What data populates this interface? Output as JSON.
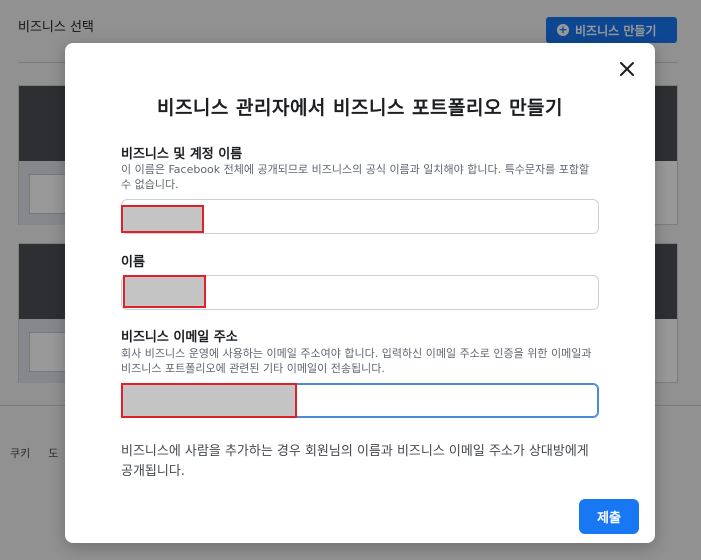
{
  "background": {
    "page_title": "비즈니스 선택",
    "create_button_label": "비즈니스 만들기",
    "footer_links": [
      "쿠키",
      "도"
    ]
  },
  "modal": {
    "title": "비즈니스 관리자에서 비즈니스 포트폴리오 만들기",
    "business_name": {
      "label": "비즈니스 및 계정 이름",
      "help": "이 이름은 Facebook 전체에 공개되므로 비즈니스의 공식 이름과 일치해야 합니다. 특수문자를 포함할 수 없습니다.",
      "value": ""
    },
    "name": {
      "label": "이름",
      "value": ""
    },
    "business_email": {
      "label": "비즈니스 이메일 주소",
      "help": "회사 비즈니스 운영에 사용하는 이메일 주소여야 합니다. 입력하신 이메일 주소로 인증을 위한 이메일과 비즈니스 포트폴리오에 관련된 기타 이메일이 전송됩니다.",
      "value": ""
    },
    "info": "비즈니스에 사람을 추가하는 경우 회원님의 이름과 비즈니스 이메일 주소가 상대방에게 공개됩니다.",
    "submit_label": "제출"
  },
  "colors": {
    "primary": "#1877f2",
    "redaction_border": "#e0202a"
  }
}
